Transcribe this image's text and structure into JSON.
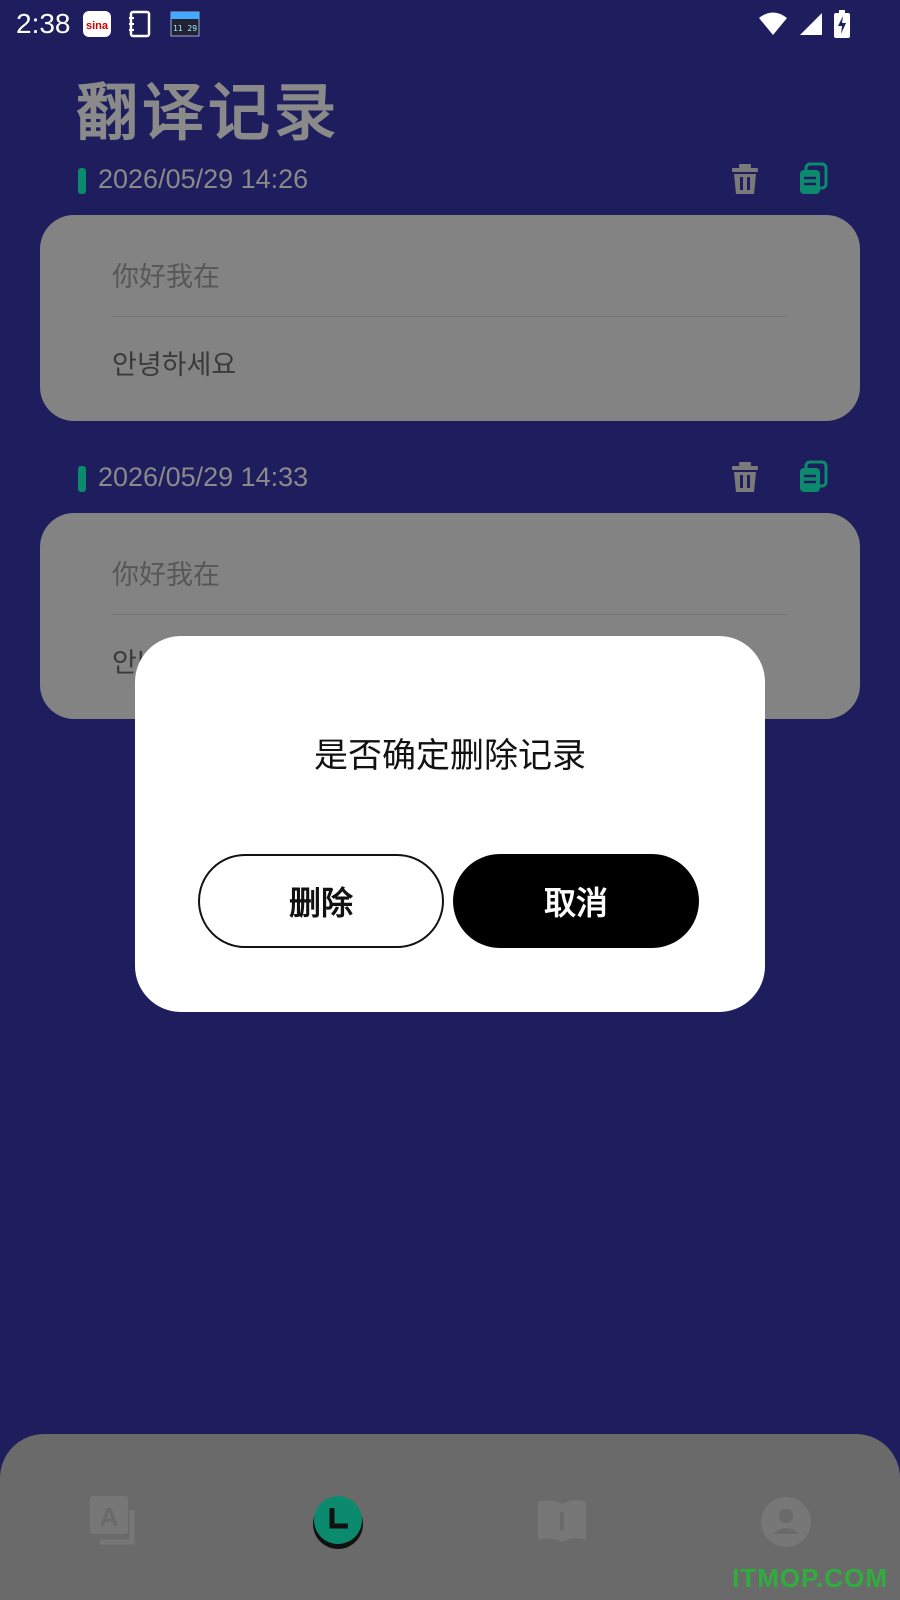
{
  "status_bar": {
    "time": "2:38",
    "notification_icons": [
      "sina-icon",
      "notebook-icon",
      "calendar-widget-icon"
    ],
    "system_icons": [
      "wifi-icon",
      "signal-icon",
      "battery-charging-icon"
    ]
  },
  "page": {
    "title": "翻译记录"
  },
  "records": [
    {
      "timestamp": "2026/05/29 14:26",
      "source": "你好我在",
      "translation": "안녕하세요"
    },
    {
      "timestamp": "2026/05/29 14:33",
      "source": "你好我在",
      "translation": "안녕하세요"
    }
  ],
  "record_actions": {
    "delete_icon": "trash-icon",
    "copy_icon": "copy-icon"
  },
  "dialog": {
    "message": "是否确定删除记录",
    "delete_label": "删除",
    "cancel_label": "取消"
  },
  "bottom_nav": {
    "items": [
      {
        "icon": "translate-icon",
        "active": false
      },
      {
        "icon": "history-clock-icon",
        "active": true
      },
      {
        "icon": "book-icon",
        "active": false
      },
      {
        "icon": "profile-icon",
        "active": false
      }
    ]
  },
  "watermark": "ITMOP.COM",
  "colors": {
    "background": "#1e1e5e",
    "accent": "#0c8a6d",
    "card": "#838383",
    "dialog": "#ffffff"
  }
}
